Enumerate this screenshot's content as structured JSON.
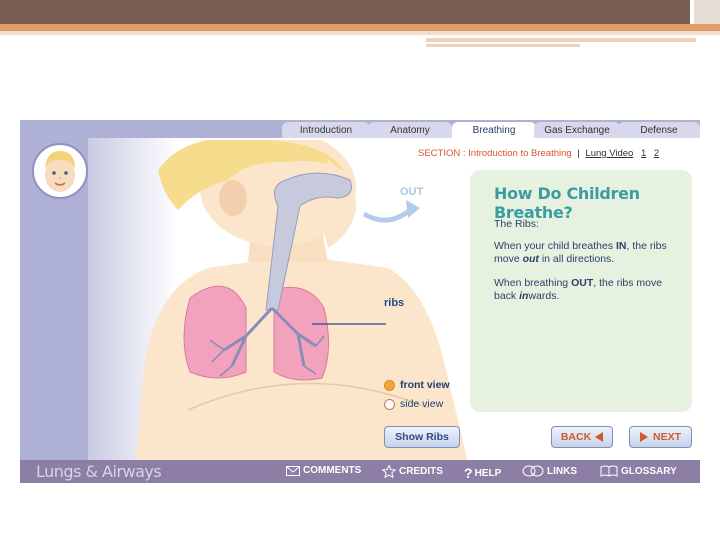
{
  "app": {
    "brand": "Lungs & Airways"
  },
  "tabs": [
    {
      "label": "Introduction"
    },
    {
      "label": "Anatomy"
    },
    {
      "label": "Breathing",
      "active": true
    },
    {
      "label": "Gas Exchange"
    },
    {
      "label": "Defense"
    }
  ],
  "section": {
    "prefix": "SECTION :",
    "name": "Introduction to Breathing",
    "video_link": "Lung Video",
    "page1": "1",
    "page2": "2"
  },
  "illustration": {
    "out_label": "OUT",
    "ribs_label": "ribs"
  },
  "view_options": {
    "front": {
      "label": "front view",
      "selected": true
    },
    "side": {
      "label": "side view",
      "selected": false
    }
  },
  "panel": {
    "title": "How Do Children Breathe?",
    "subtitle": "The Ribs:",
    "p1_a": "When your child breathes ",
    "p1_b": "IN",
    "p1_c": ", the ribs move ",
    "p1_d": "out",
    "p1_e": " in all directions.",
    "p2_a": "When breathing ",
    "p2_b": "OUT",
    "p2_c": ", the ribs move back ",
    "p2_d": "in",
    "p2_e": "wards."
  },
  "buttons": {
    "show_ribs": "Show Ribs",
    "back": "BACK",
    "next": "NEXT"
  },
  "footer": {
    "comments": "COMMENTS",
    "credits": "CREDITS",
    "help": "HELP",
    "links": "LINKS",
    "glossary": "GLOSSARY"
  },
  "icons": [
    "envelope-icon",
    "star-icon",
    "question-icon",
    "links-icon",
    "book-icon",
    "triangle-left-icon",
    "triangle-right-icon",
    "child-avatar-icon"
  ]
}
